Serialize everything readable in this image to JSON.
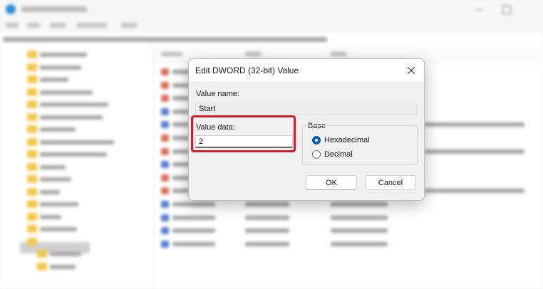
{
  "dialog": {
    "title": "Edit DWORD (32-bit) Value",
    "value_name_label": "Value name:",
    "value_name": "Start",
    "value_data_label": "Value data:",
    "value_data": "2",
    "base_label": "Base",
    "base_options": [
      "Hexadecimal",
      "Decimal"
    ],
    "base_selected": "Hexadecimal",
    "ok_label": "OK",
    "cancel_label": "Cancel",
    "highlight_color": "#d0202f"
  },
  "background": {
    "app_icon_color": "#2c8fd6",
    "folder_color": "#f2c84b",
    "reg_sz_icon_color": "#d97059",
    "reg_dword_icon_color": "#5a7fd0"
  }
}
